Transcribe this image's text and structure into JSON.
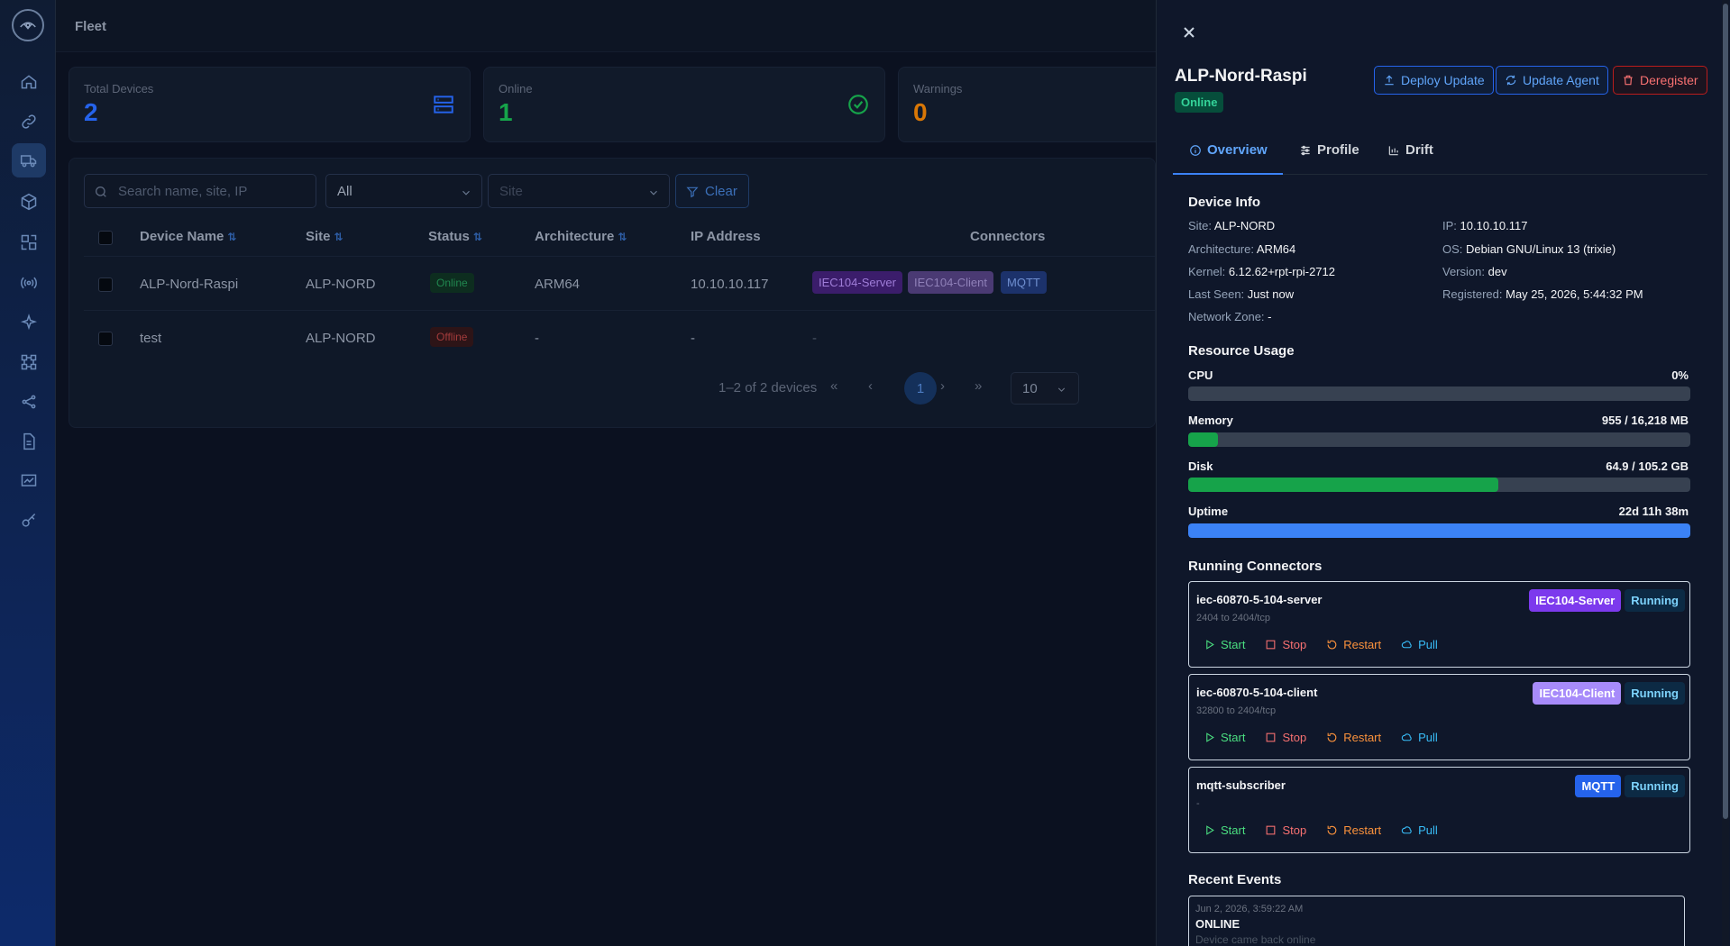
{
  "nav": {
    "items": [
      "home-icon",
      "link-icon",
      "truck-icon",
      "cube-icon",
      "swap-icon",
      "radio-icon",
      "sparkle-icon",
      "network-icon",
      "share-icon",
      "file-icon",
      "chart-icon",
      "key-icon"
    ],
    "active_index": 2
  },
  "header": {
    "title": "Fleet"
  },
  "stats": [
    {
      "label": "Total Devices",
      "value": "2",
      "color": "#2563eb"
    },
    {
      "label": "Online",
      "value": "1",
      "color": "#16a34a"
    },
    {
      "label": "Warnings",
      "value": "0",
      "color": "#d97706"
    }
  ],
  "filters": {
    "search_placeholder": "Search name, site, IP",
    "status_value": "All",
    "site_placeholder": "Site",
    "clear_label": "Clear"
  },
  "table": {
    "columns": [
      "Device Name",
      "Site",
      "Status",
      "Architecture",
      "IP Address",
      "Connectors"
    ],
    "rows": [
      {
        "name": "ALP-Nord-Raspi",
        "site": "ALP-NORD",
        "status": "Online",
        "arch": "ARM64",
        "ip": "10.10.10.117",
        "connectors": [
          "IEC104-Server",
          "IEC104-Client",
          "MQTT"
        ]
      },
      {
        "name": "test",
        "site": "ALP-NORD",
        "status": "Offline",
        "arch": "-",
        "ip": "-",
        "connectors_text": "-"
      }
    ],
    "pagination": {
      "summary": "1–2 of 2 devices",
      "current_page": "1",
      "page_size": "10"
    }
  },
  "drawer": {
    "title": "ALP-Nord-Raspi",
    "status": "Online",
    "actions": {
      "deploy": "Deploy Update",
      "update_agent": "Update Agent",
      "deregister": "Deregister"
    },
    "tabs": [
      "Overview",
      "Profile",
      "Drift"
    ],
    "device_info": {
      "title": "Device Info",
      "site_label": "Site:",
      "site": "ALP-NORD",
      "ip_label": "IP:",
      "ip": "10.10.10.117",
      "arch_label": "Architecture:",
      "arch": "ARM64",
      "os_label": "OS:",
      "os": "Debian GNU/Linux 13 (trixie)",
      "kernel_label": "Kernel:",
      "kernel": "6.12.62+rpt-rpi-2712",
      "version_label": "Version:",
      "version": "dev",
      "last_seen_label": "Last Seen:",
      "last_seen": "Just now",
      "registered_label": "Registered:",
      "registered": "May 25, 2026, 5:44:32 PM",
      "zone_label": "Network Zone:",
      "zone": "-"
    },
    "resources": {
      "title": "Resource Usage",
      "items": [
        {
          "label": "CPU",
          "value": "0%",
          "fraction": 0.0,
          "color": "#16a34a"
        },
        {
          "label": "Memory",
          "value": "955 / 16,218 MB",
          "fraction": 0.059,
          "color": "#16a34a"
        },
        {
          "label": "Disk",
          "value": "64.9 / 105.2 GB",
          "fraction": 0.617,
          "color": "#16a34a"
        },
        {
          "label": "Uptime",
          "value": "22d 11h 38m",
          "fraction": 1.0,
          "color": "#3b82f6"
        }
      ]
    },
    "connectors": {
      "title": "Running Connectors",
      "items": [
        {
          "name": "iec-60870-5-104-server",
          "ports": "2404 to 2404/tcp",
          "type": "IEC104-Server",
          "type_bg": "#7c3aed",
          "state": "Running"
        },
        {
          "name": "iec-60870-5-104-client",
          "ports": "32800 to 2404/tcp",
          "type": "IEC104-Client",
          "type_bg": "#a78bfa",
          "state": "Running"
        },
        {
          "name": "mqtt-subscriber",
          "ports": "-",
          "type": "MQTT",
          "type_bg": "#2563eb",
          "state": "Running"
        }
      ],
      "actions": {
        "start": "Start",
        "stop": "Stop",
        "restart": "Restart",
        "pull": "Pull"
      }
    },
    "events": {
      "title": "Recent Events",
      "items": [
        {
          "time": "Jun 2, 2026, 3:59:22 AM",
          "title": "ONLINE",
          "desc": "Device came back online"
        }
      ]
    }
  }
}
